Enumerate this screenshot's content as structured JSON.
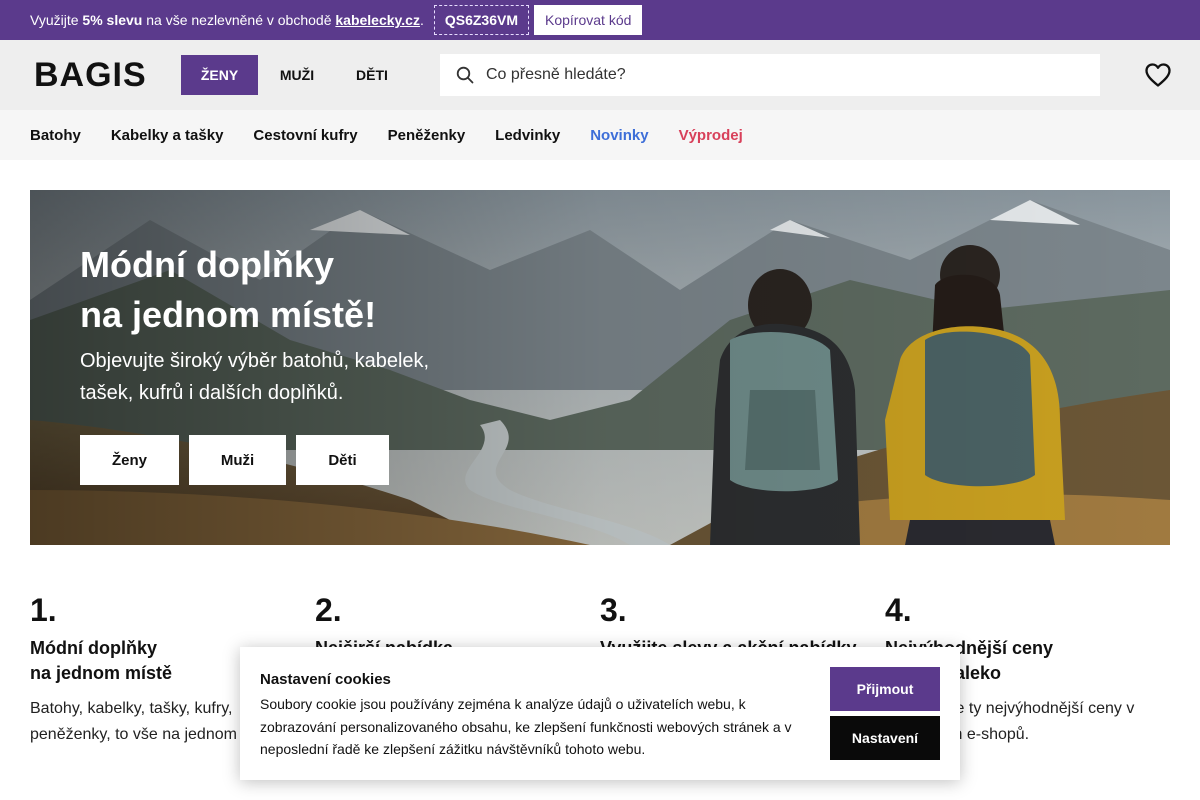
{
  "promo": {
    "prefix": "Využijte",
    "discount": "5% slevu",
    "middle": "na vše nezlevněné v obchodě",
    "shop": "kabelecky.cz",
    "dot": ".",
    "code": "QS6Z36VM",
    "copy_label": "Kopírovat kód"
  },
  "header": {
    "logo": "BAGIS",
    "gender_tabs": [
      "ŽENY",
      "MUŽI",
      "DĚTI"
    ],
    "search_placeholder": "Co přesně hledáte?"
  },
  "categories": [
    {
      "label": "Batohy",
      "style": "normal"
    },
    {
      "label": "Kabelky a tašky",
      "style": "normal"
    },
    {
      "label": "Cestovní kufry",
      "style": "normal"
    },
    {
      "label": "Peněženky",
      "style": "normal"
    },
    {
      "label": "Ledvinky",
      "style": "normal"
    },
    {
      "label": "Novinky",
      "style": "new"
    },
    {
      "label": "Výprodej",
      "style": "sale"
    }
  ],
  "hero": {
    "title_line1": "Módní doplňky",
    "title_line2": "na jednom místě!",
    "subtitle": "Objevujte široký výběr batohů, kabelek, tašek, kufrů i dalších doplňků.",
    "buttons": [
      "Ženy",
      "Muži",
      "Děti"
    ]
  },
  "benefits": [
    {
      "num": "1.",
      "title_line1": "Módní doplňky",
      "title_line2": "na jednom místě",
      "text": "Batohy, kabelky, tašky, kufry, peněženky, to vše na jednom"
    },
    {
      "num": "2.",
      "title_line1": "Nejširší nabídka",
      "title_line2": "",
      "text": ""
    },
    {
      "num": "3.",
      "title_line1": "Využijte slevy a akční nabídky",
      "title_line2": "",
      "text": ""
    },
    {
      "num": "4.",
      "title_line1": "Nejvýhodnější ceny",
      "title_line2": "široko daleko",
      "text": "Vyhledáme ty nejvýhodnější ceny v oblíbených e-shopů."
    }
  ],
  "cookie": {
    "title": "Nastavení cookies",
    "text": "Soubory cookie jsou používány zejména k analýze údajů o uživatelích webu, k zobrazování personalizovaného obsahu, ke zlepšení funkčnosti webových stránek a v neposlední řadě ke zlepšení zážitku návštěvníků tohoto webu.",
    "accept_label": "Přijmout",
    "settings_label": "Nastavení"
  },
  "colors": {
    "brand_purple": "#5b3a8c",
    "novinky_blue": "#3d6ed8",
    "vyprodej_red": "#d8405a"
  },
  "icons": [
    "search-icon",
    "heart-icon"
  ]
}
